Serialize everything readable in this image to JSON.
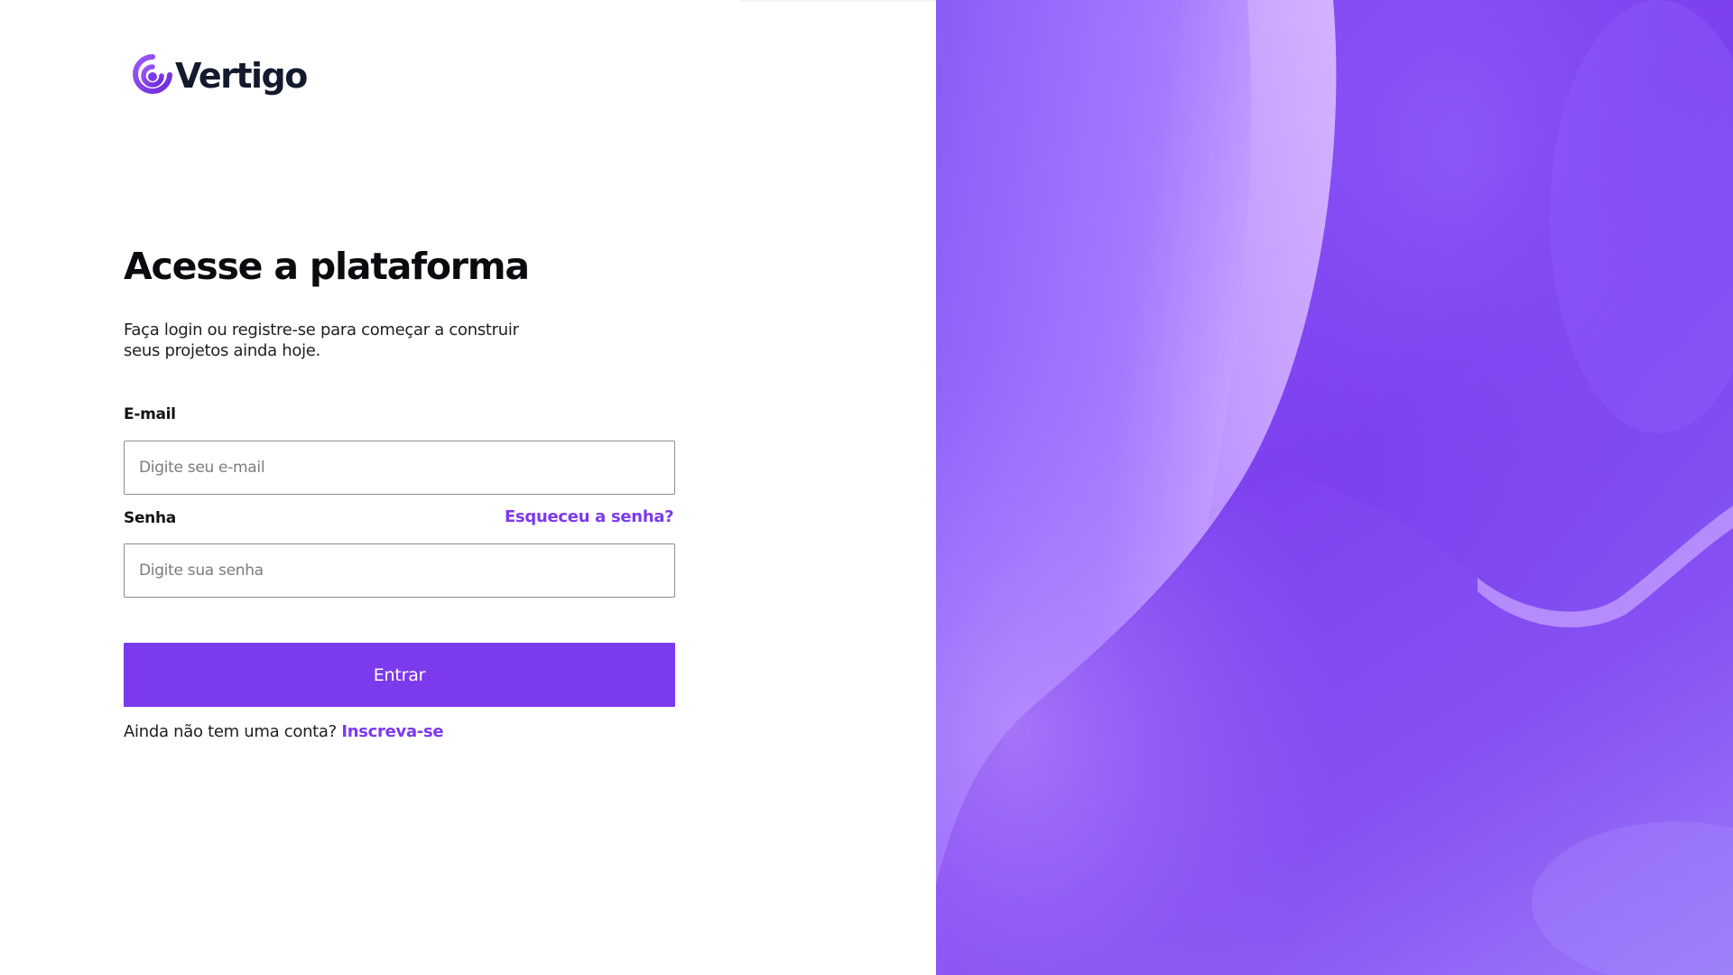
{
  "brand": {
    "name": "Vertigo",
    "logo_icon": "signal-rings-icon",
    "accent_color": "#7c3aed",
    "text_color": "#141a2e"
  },
  "login": {
    "heading": "Acesse a plataforma",
    "subtitle_line1": "Faça login ou registre-se para começar a construir",
    "subtitle_line2": "seus projetos ainda hoje.",
    "email": {
      "label": "E-mail",
      "placeholder": "Digite seu e-mail",
      "value": ""
    },
    "password": {
      "label": "Senha",
      "placeholder": "Digite sua senha",
      "value": "",
      "forgot_link": "Esqueceu a senha?"
    },
    "submit_label": "Entrar",
    "signup_prompt": "Ainda não tem uma conta?",
    "signup_link": "Inscreva-se"
  },
  "decor": {
    "panel_image": "abstract-purple-waves",
    "colors": {
      "base": "#7c3fef",
      "light": "#c49cff",
      "mid": "#9b6bff",
      "deep": "#6a2fe6"
    }
  }
}
